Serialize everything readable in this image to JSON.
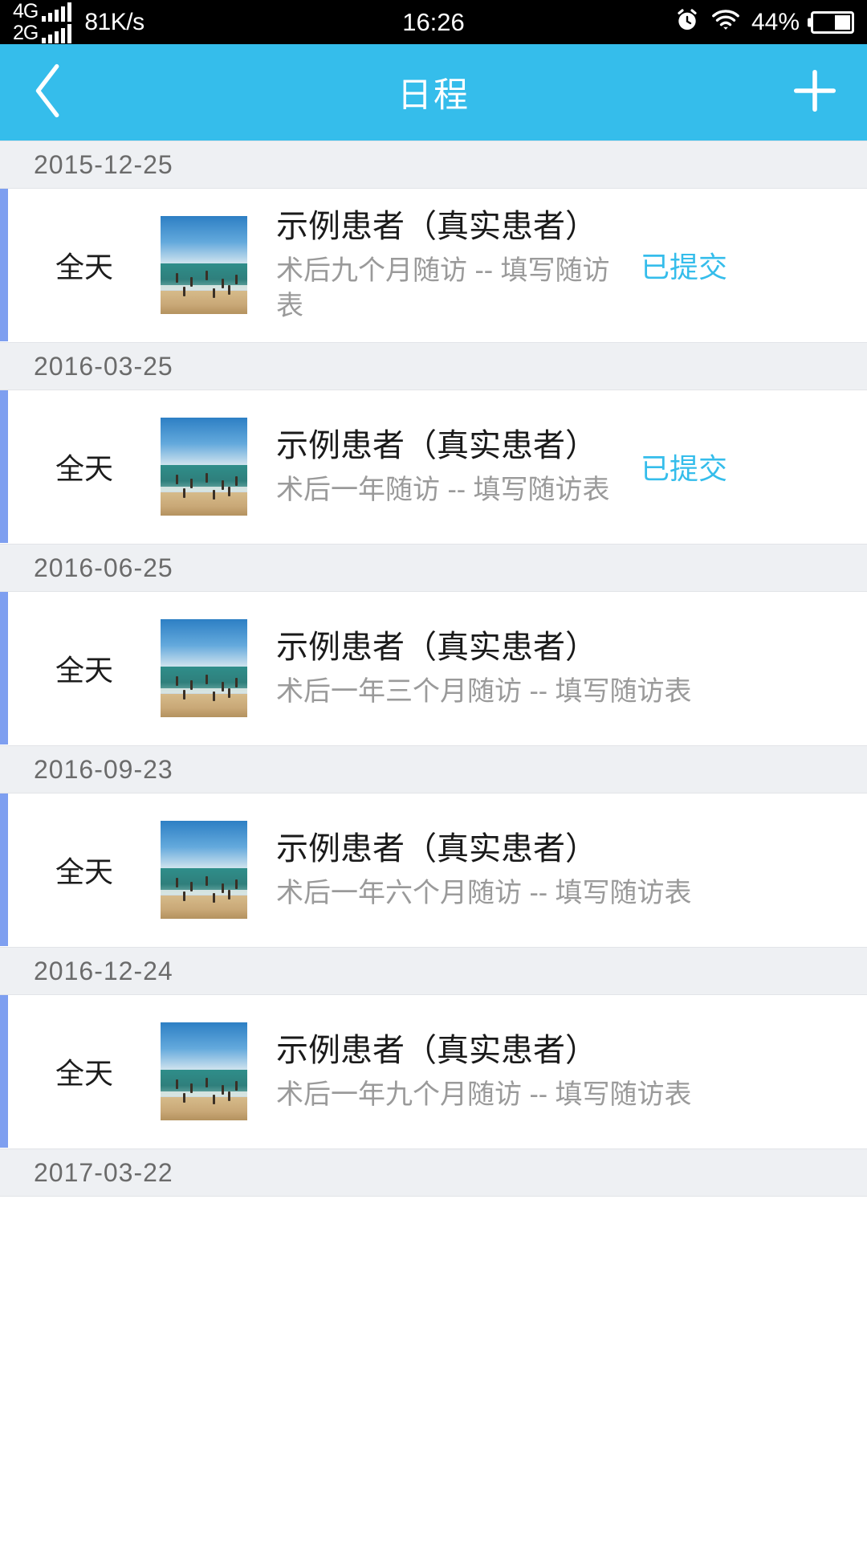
{
  "status_bar": {
    "sim1_label": "4G",
    "sim2_label": "2G",
    "network_speed": "81K/s",
    "time": "16:26",
    "battery_percent": "44%",
    "icons": [
      "alarm-clock-icon",
      "wifi-icon",
      "battery-icon"
    ]
  },
  "header": {
    "back_icon": "chevron-left-icon",
    "title": "日程",
    "add_icon": "plus-icon",
    "background_color": "#35bdeb"
  },
  "theme": {
    "accent_blue": "#35bdeb",
    "event_bar_blue": "#7e9ff0",
    "date_header_bg": "#eef0f3",
    "subtitle_gray": "#9a9a9a"
  },
  "sections": [
    {
      "date": "2015-12-25",
      "events": [
        {
          "time_label": "全天",
          "thumbnail": "beach-photo-thumbnail",
          "title": "示例患者（真实患者）",
          "subtitle": "术后九个月随访 -- 填写随访表",
          "status": "已提交",
          "narrow": true
        }
      ]
    },
    {
      "date": "2016-03-25",
      "events": [
        {
          "time_label": "全天",
          "thumbnail": "beach-photo-thumbnail",
          "title": "示例患者（真实患者）",
          "subtitle": "术后一年随访 -- 填写随访表",
          "status": "已提交",
          "narrow": true
        }
      ]
    },
    {
      "date": "2016-06-25",
      "events": [
        {
          "time_label": "全天",
          "thumbnail": "beach-photo-thumbnail",
          "title": "示例患者（真实患者）",
          "subtitle": "术后一年三个月随访 -- 填写随访表",
          "status": "",
          "narrow": false
        }
      ]
    },
    {
      "date": "2016-09-23",
      "events": [
        {
          "time_label": "全天",
          "thumbnail": "beach-photo-thumbnail",
          "title": "示例患者（真实患者）",
          "subtitle": "术后一年六个月随访 -- 填写随访表",
          "status": "",
          "narrow": false
        }
      ]
    },
    {
      "date": "2016-12-24",
      "events": [
        {
          "time_label": "全天",
          "thumbnail": "beach-photo-thumbnail",
          "title": "示例患者（真实患者）",
          "subtitle": "术后一年九个月随访 -- 填写随访表",
          "status": "",
          "narrow": false
        }
      ]
    },
    {
      "date": "2017-03-22",
      "events": []
    }
  ]
}
